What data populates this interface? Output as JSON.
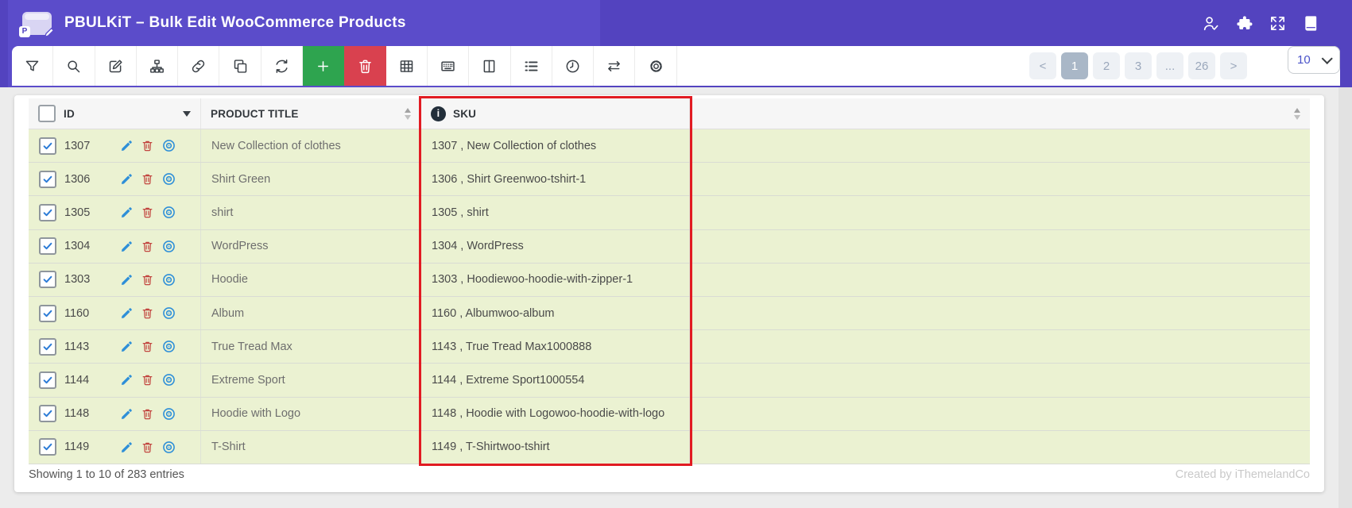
{
  "app": {
    "title": "PBULKiT – Bulk Edit WooCommerce Products",
    "logo_letter": "P"
  },
  "header_icons": [
    {
      "icon": "user-check-icon"
    },
    {
      "icon": "puzzle-icon"
    },
    {
      "icon": "fullscreen-icon"
    },
    {
      "icon": "book-icon"
    }
  ],
  "toolbar": {
    "buttons": [
      {
        "id": "filter",
        "icon": "filter-icon",
        "variant": ""
      },
      {
        "id": "search",
        "icon": "search-icon",
        "variant": ""
      },
      {
        "id": "bulk-edit",
        "icon": "edit-icon",
        "variant": ""
      },
      {
        "id": "hierarchy",
        "icon": "sitemap-icon",
        "variant": ""
      },
      {
        "id": "bind-edit",
        "icon": "link-icon",
        "variant": ""
      },
      {
        "id": "duplicate",
        "icon": "copy-icon",
        "variant": ""
      },
      {
        "id": "refresh",
        "icon": "refresh-icon",
        "variant": ""
      },
      {
        "id": "add-product",
        "icon": "plus-icon",
        "variant": "green"
      },
      {
        "id": "delete-products",
        "icon": "trash-icon",
        "variant": "red"
      },
      {
        "id": "column-manager",
        "icon": "table-icon",
        "variant": ""
      },
      {
        "id": "meta-fields",
        "icon": "keyboard-icon",
        "variant": ""
      },
      {
        "id": "split-view",
        "icon": "columns-icon",
        "variant": ""
      },
      {
        "id": "list-view",
        "icon": "list-icon",
        "variant": ""
      },
      {
        "id": "history",
        "icon": "clock-icon",
        "variant": ""
      },
      {
        "id": "swap",
        "icon": "repeat-icon",
        "variant": ""
      },
      {
        "id": "settings",
        "icon": "gear-icon",
        "variant": ""
      }
    ]
  },
  "pagination": {
    "prev": "<",
    "pages": [
      "1",
      "2",
      "3",
      "...",
      "26"
    ],
    "active": "1",
    "next": ">",
    "page_size": "10"
  },
  "table": {
    "columns": {
      "id": "ID",
      "title": "PRODUCT TITLE",
      "sku": "SKU"
    },
    "info_glyph": "i",
    "rows": [
      {
        "id": "1307",
        "title": "New Collection of clothes",
        "sku": "1307 , New Collection of clothes"
      },
      {
        "id": "1306",
        "title": "Shirt Green",
        "sku": "1306 , Shirt Greenwoo-tshirt-1"
      },
      {
        "id": "1305",
        "title": "shirt",
        "sku": "1305 , shirt"
      },
      {
        "id": "1304",
        "title": "WordPress",
        "sku": "1304 , WordPress"
      },
      {
        "id": "1303",
        "title": "Hoodie",
        "sku": "1303 , Hoodiewoo-hoodie-with-zipper-1"
      },
      {
        "id": "1160",
        "title": "Album",
        "sku": "1160 , Albumwoo-album"
      },
      {
        "id": "1143",
        "title": "True Tread Max",
        "sku": "1143 , True Tread Max1000888"
      },
      {
        "id": "1144",
        "title": "Extreme Sport",
        "sku": "1144 , Extreme Sport1000554"
      },
      {
        "id": "1148",
        "title": "Hoodie with Logo",
        "sku": "1148 , Hoodie with Logowoo-hoodie-with-logo"
      },
      {
        "id": "1149",
        "title": "T-Shirt",
        "sku": "1149 , T-Shirtwoo-tshirt"
      }
    ]
  },
  "footer": {
    "showing": "Showing 1 to 10 of 283 entries",
    "credit": "Created by iThemelandCo"
  },
  "colors": {
    "purple": "#5343bf",
    "purple_light": "#5b4cca",
    "green": "#2ea44f",
    "red": "#d9414f",
    "row_bg": "#ebf2d2",
    "highlight_border": "#e11b22",
    "active_page_bg": "#a9b7c7"
  }
}
